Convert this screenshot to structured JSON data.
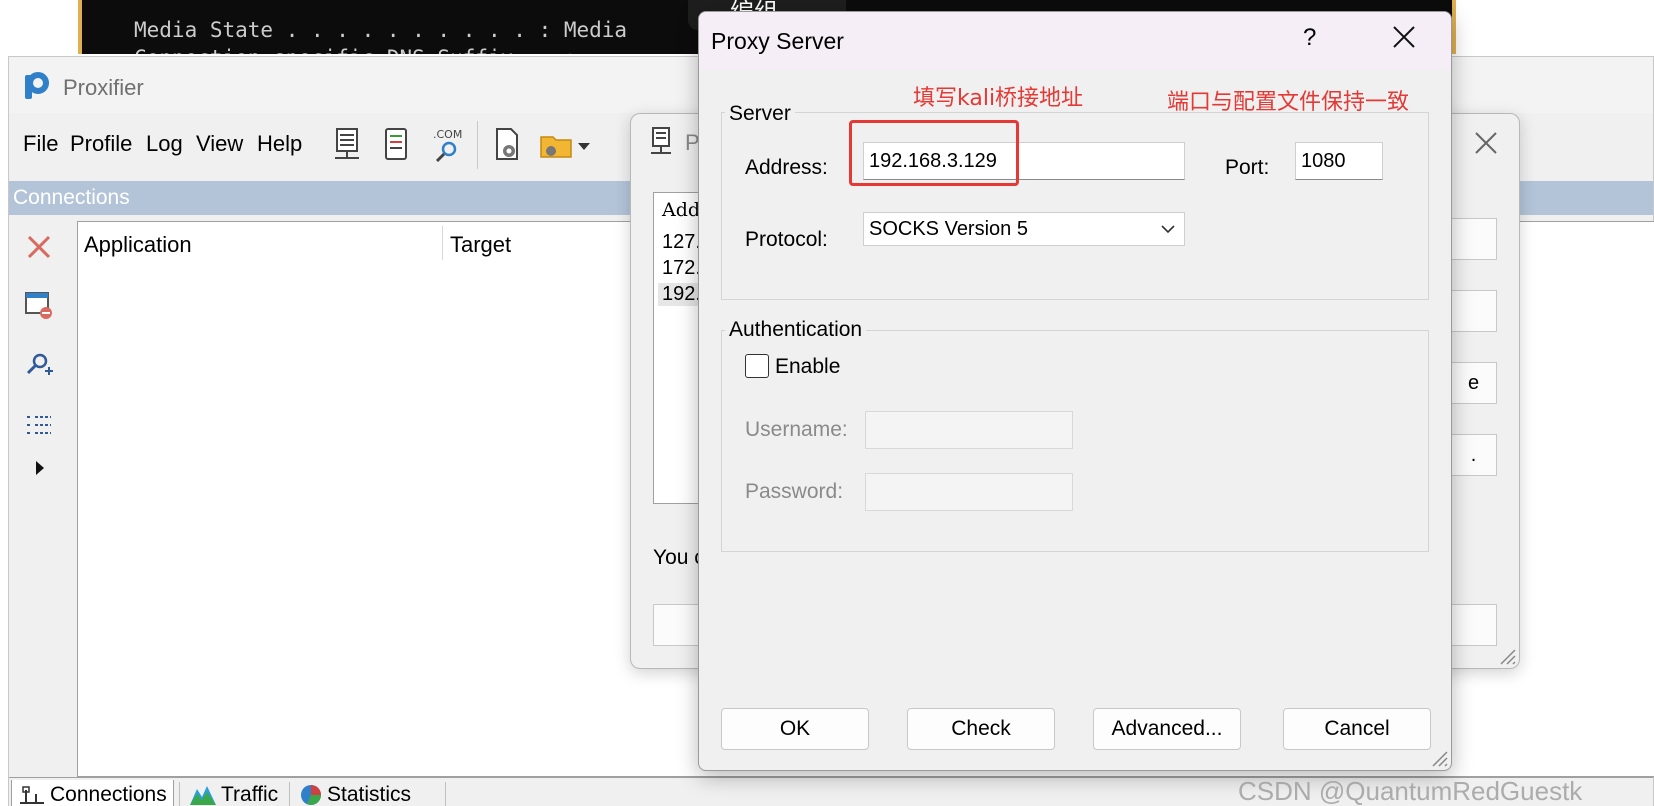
{
  "terminal": {
    "line1": "Media State . . . . . . . . . . : Media",
    "line2": "Connection-specific DNS Suffix  . :",
    "ime_badge": "编组"
  },
  "app": {
    "title": "Proxifier",
    "menu": [
      "File",
      "Profile",
      "Log",
      "View",
      "Help"
    ],
    "connections_header": "Connections",
    "columns": [
      "Application",
      "Target"
    ],
    "bottom_tabs": [
      "Connections",
      "Traffic",
      "Statistics"
    ]
  },
  "servers_dialog": {
    "title_partial": "P",
    "list_header": "Addr",
    "rows": [
      "127.",
      "172.",
      "192."
    ],
    "note_partial": "You c",
    "right_button_fragments": [
      "",
      "",
      "e",
      "."
    ]
  },
  "proxy_dialog": {
    "title": "Proxy Server",
    "help": "?",
    "server_group": "Server",
    "address_label": "Address:",
    "address_value": "192.168.3.129",
    "port_label": "Port:",
    "port_value": "1080",
    "protocol_label": "Protocol:",
    "protocol_value": "SOCKS Version 5",
    "auth_group": "Authentication",
    "enable_label": "Enable",
    "enable_checked": false,
    "username_label": "Username:",
    "username_value": "",
    "password_label": "Password:",
    "password_value": "",
    "buttons": {
      "ok": "OK",
      "check": "Check",
      "advanced": "Advanced...",
      "cancel": "Cancel"
    }
  },
  "annotations": {
    "address_note": "填写kali桥接地址",
    "port_note": "端口与配置文件保持一致",
    "color": "#e53935"
  },
  "watermark": "CSDN @QuantumRedGuestk"
}
